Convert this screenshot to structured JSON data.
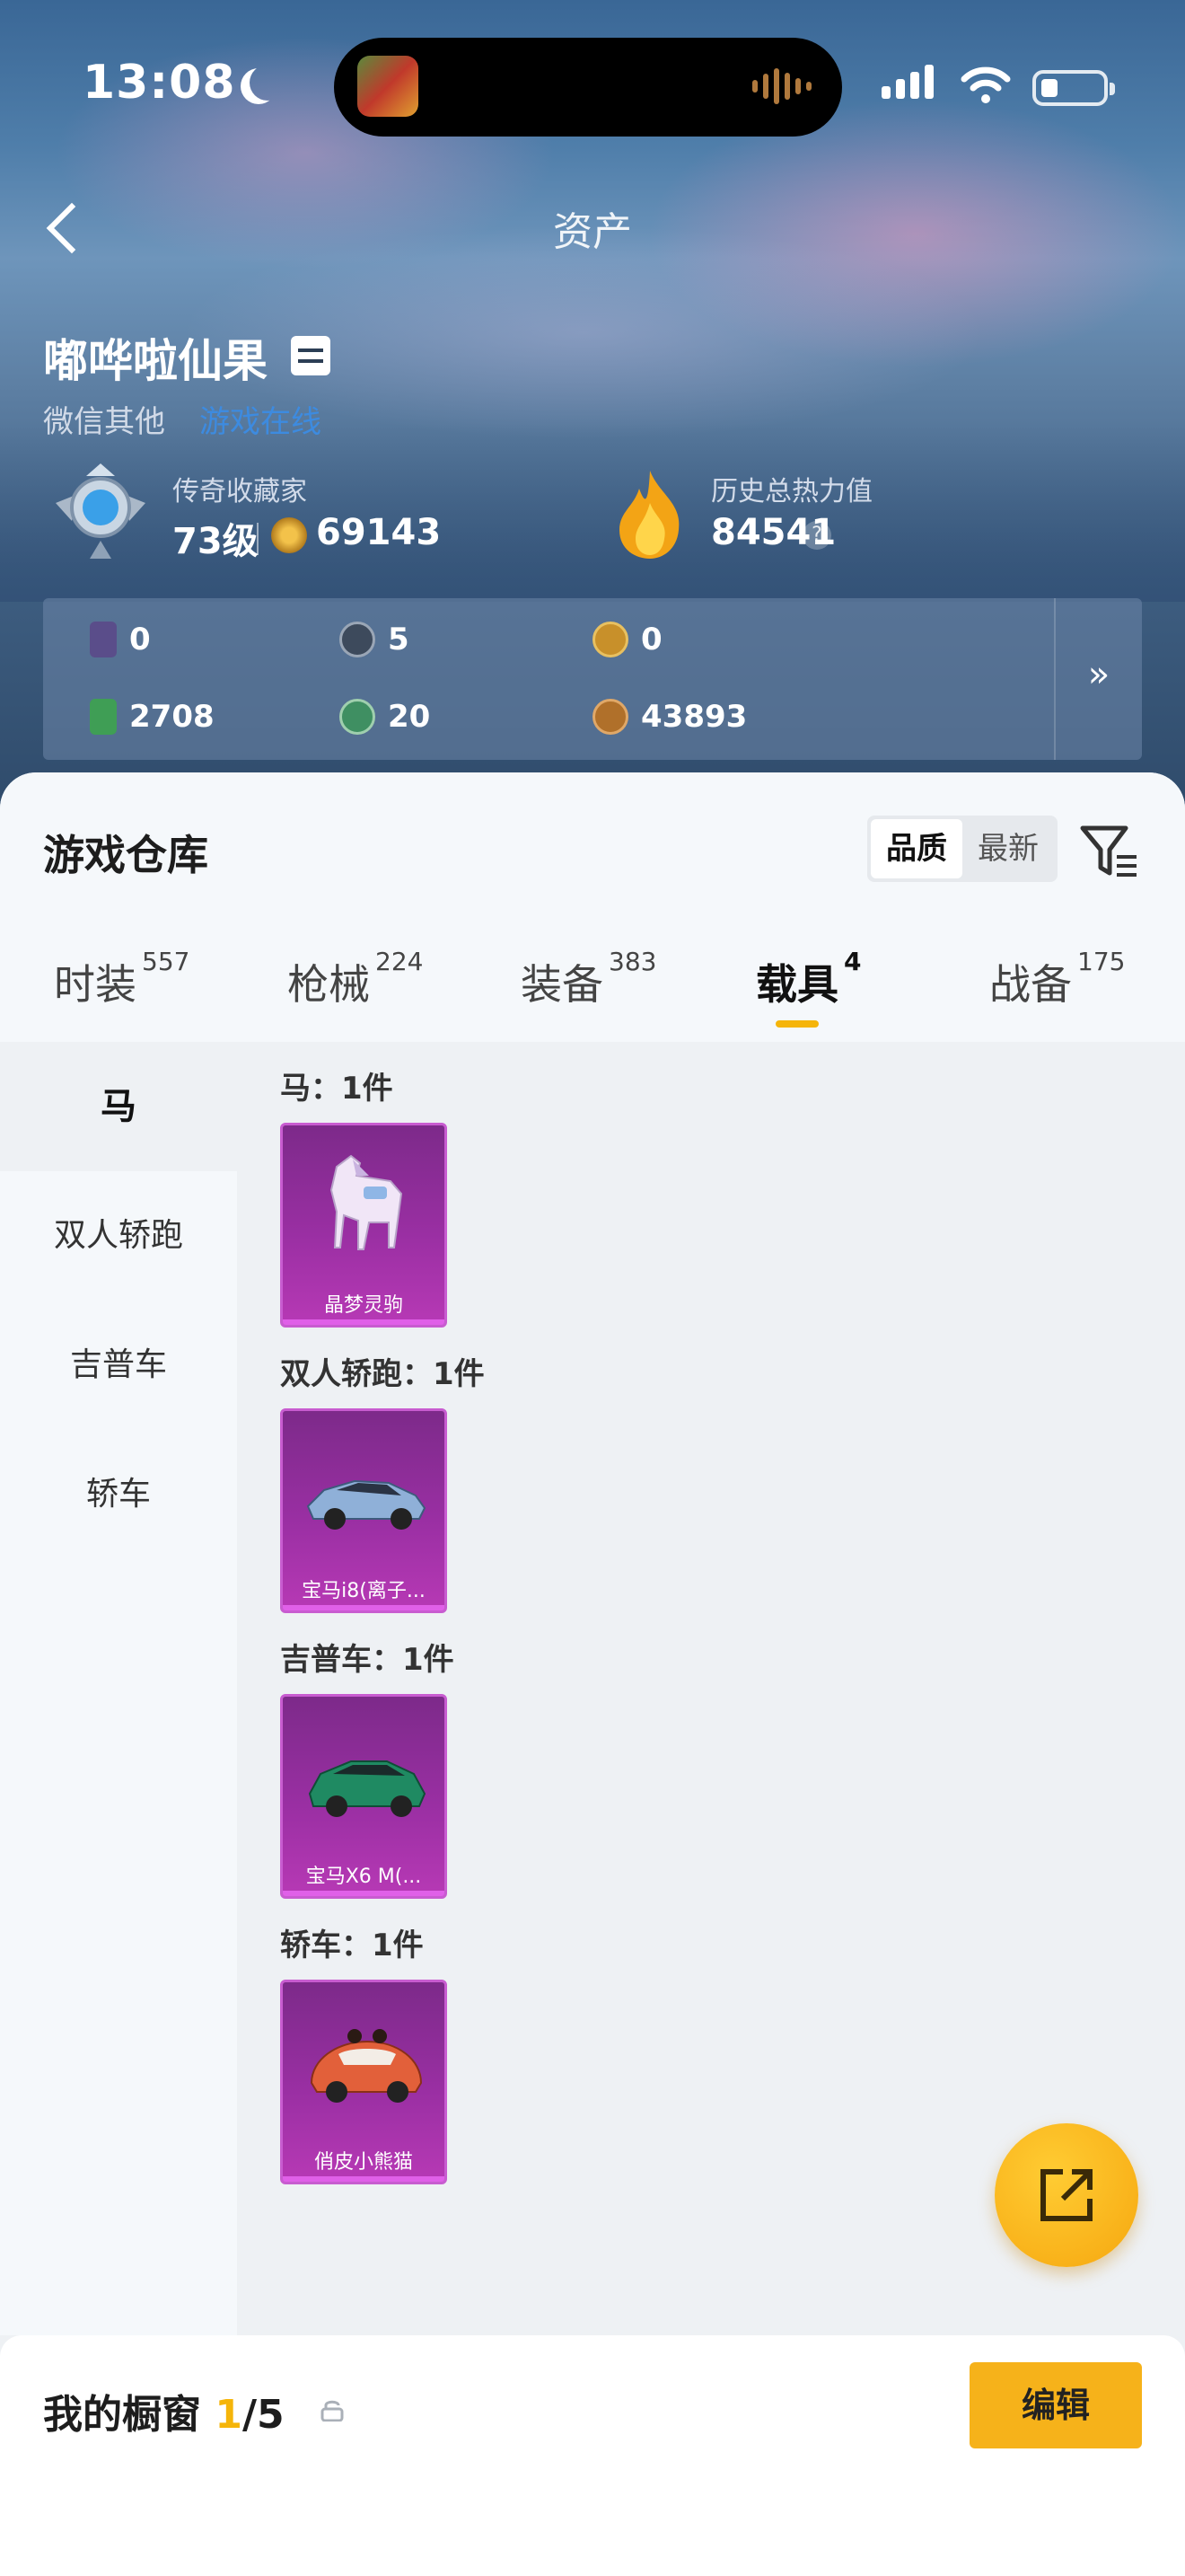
{
  "status_bar": {
    "time": "13:08"
  },
  "nav": {
    "title": "资产"
  },
  "profile": {
    "name": "嘟哗啦仙果",
    "platform": "微信其他",
    "online_status": "游戏在线"
  },
  "rank": {
    "label": "传奇收藏家",
    "level": "73级",
    "points": "69143"
  },
  "heat": {
    "label": "历史总热力值",
    "value": "84541",
    "help": "?"
  },
  "currencies": [
    {
      "icon": "card-icon",
      "value": "0",
      "color": "#5a4d8a"
    },
    {
      "icon": "s-coin-icon",
      "value": "5",
      "color": "#3d4a5c"
    },
    {
      "icon": "a-coin-icon",
      "value": "0",
      "color": "#c8902a"
    },
    {
      "icon": "ticket-icon",
      "value": "2708",
      "color": "#3f9e55"
    },
    {
      "icon": "green-coin-icon",
      "value": "20",
      "color": "#3f8f62"
    },
    {
      "icon": "bronze-coin-icon",
      "value": "43893",
      "color": "#b0702a"
    }
  ],
  "currency_more": "»",
  "warehouse": {
    "title": "游戏仓库",
    "sort_options": [
      "品质",
      "最新"
    ],
    "sort_active": "品质",
    "tabs": [
      {
        "label": "时装",
        "count": "557"
      },
      {
        "label": "枪械",
        "count": "224"
      },
      {
        "label": "装备",
        "count": "383"
      },
      {
        "label": "载具",
        "count": "4"
      },
      {
        "label": "战备",
        "count": "175"
      }
    ],
    "active_tab": "载具",
    "side_nav": [
      "马",
      "双人轿跑",
      "吉普车",
      "轿车"
    ],
    "side_nav_active": "马",
    "groups": [
      {
        "title": "马：1件",
        "items": [
          {
            "name": "晶梦灵驹",
            "icon": "horse-icon"
          }
        ]
      },
      {
        "title": "双人轿跑：1件",
        "items": [
          {
            "name": "宝马i8(离子...",
            "icon": "sports-car-icon"
          }
        ]
      },
      {
        "title": "吉普车：1件",
        "items": [
          {
            "name": "宝马X6 M(...",
            "icon": "suv-icon"
          }
        ]
      },
      {
        "title": "轿车：1件",
        "items": [
          {
            "name": "俏皮小熊猫",
            "icon": "beetle-car-icon"
          }
        ]
      }
    ]
  },
  "showcase": {
    "label": "我的橱窗",
    "count": "1",
    "total": "/5",
    "edit": "编辑"
  },
  "colors": {
    "accent": "#f5b50a",
    "link": "#3d8be0",
    "rarity_purple": "#9a2fa3"
  }
}
